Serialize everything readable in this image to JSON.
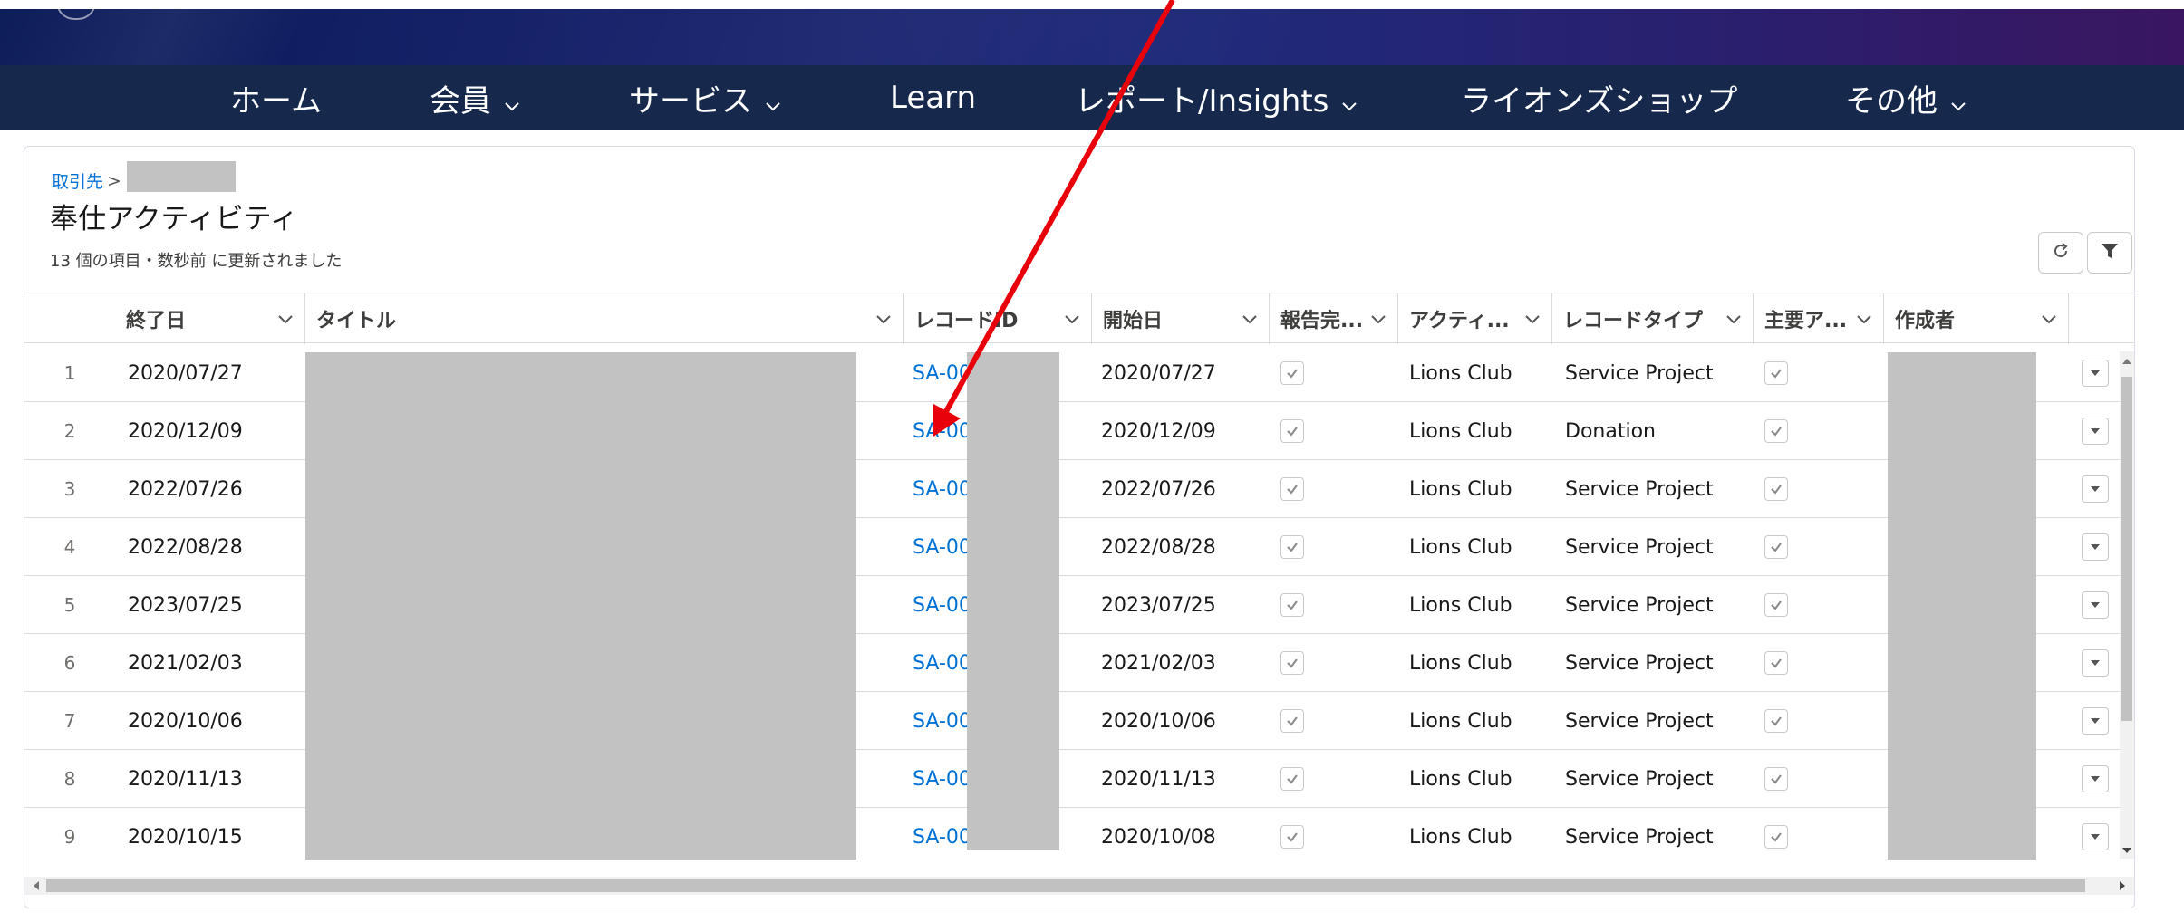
{
  "nav": {
    "items": [
      {
        "label": "ホーム",
        "has_menu": false
      },
      {
        "label": "会員",
        "has_menu": true
      },
      {
        "label": "サービス",
        "has_menu": true
      },
      {
        "label": "Learn",
        "has_menu": false
      },
      {
        "label": "レポート/Insights",
        "has_menu": true
      },
      {
        "label": "ライオンズショップ",
        "has_menu": false
      },
      {
        "label": "その他",
        "has_menu": true
      }
    ]
  },
  "card": {
    "breadcrumb": {
      "parent": "取引先",
      "separator": ">"
    },
    "title": "奉仕アクティビティ",
    "meta": "13 個の項目・数秒前 に更新されました",
    "refresh_icon": "refresh-icon",
    "filter_icon": "filter-icon"
  },
  "table": {
    "columns": [
      "終了日",
      "タイトル",
      "レコードID",
      "開始日",
      "報告完...",
      "アクティ...",
      "レコードタイプ",
      "主要ア...",
      "作成者"
    ],
    "rows": [
      {
        "num": "1",
        "end": "2020/07/27",
        "record_id": "SA-00",
        "start": "2020/07/27",
        "activity": "Lions Club",
        "type": "Service Project"
      },
      {
        "num": "2",
        "end": "2020/12/09",
        "record_id": "SA-00",
        "start": "2020/12/09",
        "activity": "Lions Club",
        "type": "Donation"
      },
      {
        "num": "3",
        "end": "2022/07/26",
        "record_id": "SA-00",
        "start": "2022/07/26",
        "activity": "Lions Club",
        "type": "Service Project"
      },
      {
        "num": "4",
        "end": "2022/08/28",
        "record_id": "SA-00",
        "start": "2022/08/28",
        "activity": "Lions Club",
        "type": "Service Project"
      },
      {
        "num": "5",
        "end": "2023/07/25",
        "record_id": "SA-00",
        "start": "2023/07/25",
        "activity": "Lions Club",
        "type": "Service Project"
      },
      {
        "num": "6",
        "end": "2021/02/03",
        "record_id": "SA-00",
        "start": "2021/02/03",
        "activity": "Lions Club",
        "type": "Service Project"
      },
      {
        "num": "7",
        "end": "2020/10/06",
        "record_id": "SA-00",
        "start": "2020/10/06",
        "activity": "Lions Club",
        "type": "Service Project"
      },
      {
        "num": "8",
        "end": "2020/11/13",
        "record_id": "SA-00",
        "start": "2020/11/13",
        "activity": "Lions Club",
        "type": "Service Project"
      },
      {
        "num": "9",
        "end": "2020/10/15",
        "record_id": "SA-00",
        "start": "2020/10/08",
        "activity": "Lions Club",
        "type": "Service Project"
      }
    ]
  },
  "colors": {
    "nav_bg": "#16294d",
    "link": "#0070d2",
    "redaction": "#c2c2c2",
    "annotation_arrow": "#e8000b"
  }
}
